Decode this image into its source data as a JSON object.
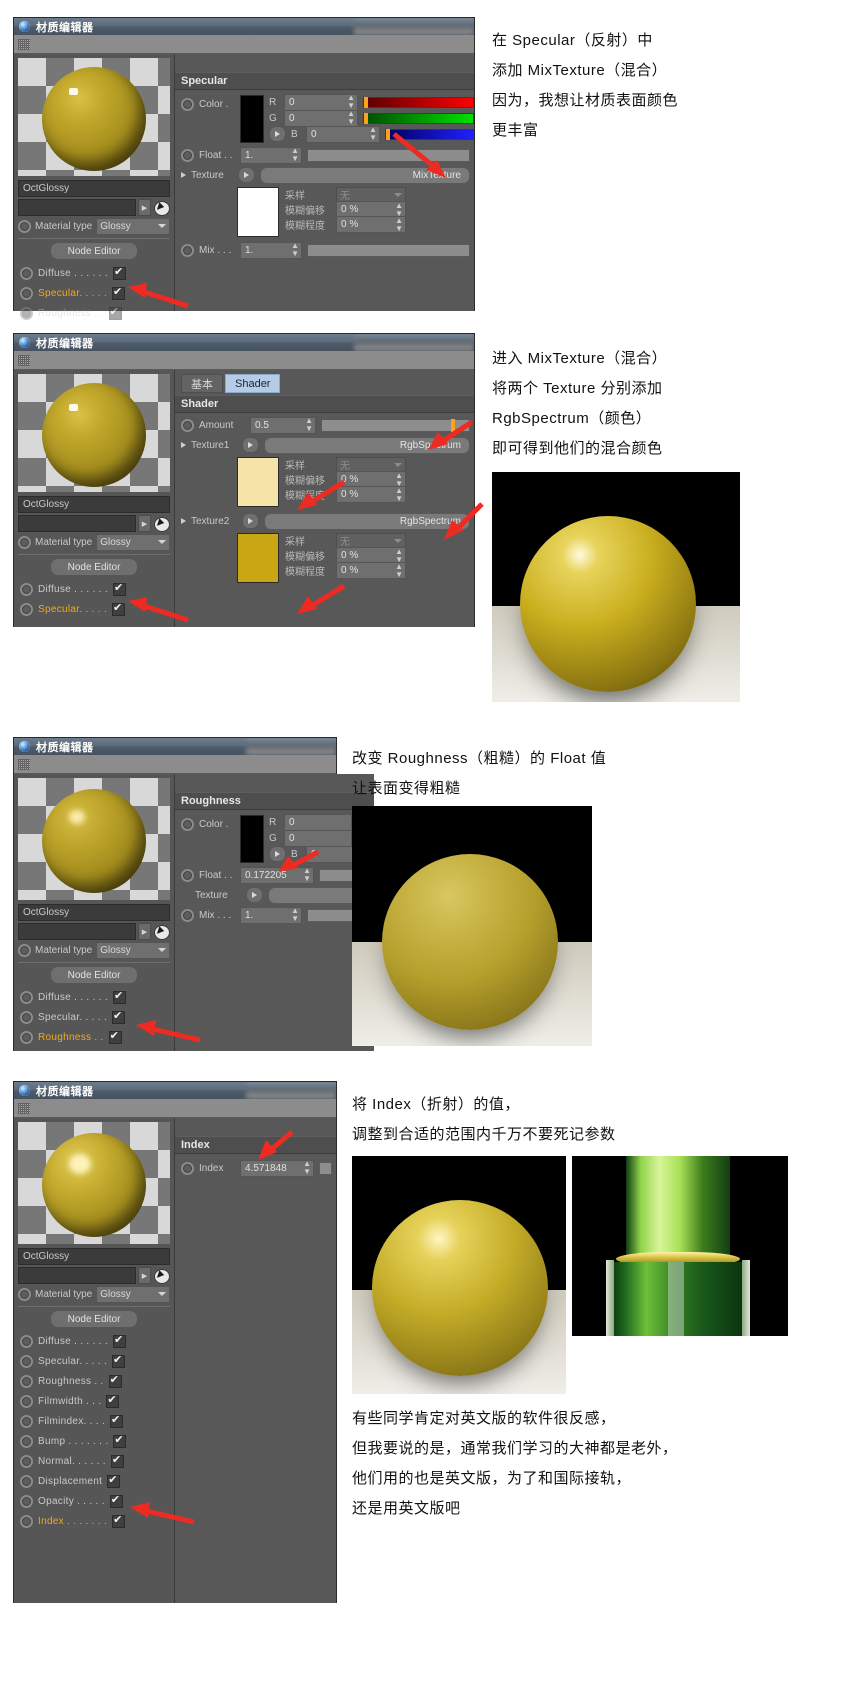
{
  "window": {
    "title": "材质编辑器",
    "logo_icon": "octane-logo-icon",
    "gripper_icon": "drag-gripper-icon"
  },
  "common": {
    "material_name": "OctGlossy",
    "material_type_label": "Material type",
    "material_type_value": "Glossy",
    "node_editor_label": "Node Editor",
    "sampling_label": "采样",
    "sampling_value": "无",
    "blur_offset_label": "模糊偏移",
    "blur_offset_value": "0 %",
    "blur_amount_label": "模糊程度",
    "blur_amount_value": "0 %",
    "cursor_icon": "pick-cursor-icon",
    "link_arrow_icon": "chevron-right-icon",
    "dropdown_icon": "chevron-down-icon",
    "expand_icon": "triangle-right-icon",
    "checkmark_icon": "check-icon",
    "radio_icon": "radio-button-icon",
    "arrow_pointer_icon": "red-arrow-icon"
  },
  "panel1": {
    "section_title": "Specular",
    "color_label": "Color .",
    "color_swatch": "#000000",
    "channels_rgb": [
      {
        "name": "R",
        "value": "0"
      },
      {
        "name": "G",
        "value": "0"
      },
      {
        "name": "B",
        "value": "0"
      }
    ],
    "float_label": "Float . .",
    "float_value": "1.",
    "texture_label": "Texture",
    "texture_value": "MixTexture",
    "texture_swatch": "#ffffff",
    "mix_label": "Mix . . .",
    "mix_value": "1.",
    "channel_list": [
      {
        "label": "Diffuse . . . . . .",
        "checked": true,
        "active": false
      },
      {
        "label": "Specular. . . . .",
        "checked": true,
        "active": true
      },
      {
        "label": "Roughness . .",
        "checked": true,
        "active": false
      }
    ]
  },
  "panel1_text": [
    "在 Specular（反射）中",
    "添加 MixTexture（混合）",
    "因为，我想让材质表面颜色",
    "更丰富"
  ],
  "panel2": {
    "tabs": [
      {
        "label": "基本",
        "selected": false
      },
      {
        "label": "Shader",
        "selected": true
      }
    ],
    "section_title": "Shader",
    "amount_label": "Amount",
    "amount_value": "0.5",
    "texture1_label": "Texture1",
    "texture1_value": "RgbSpectrum",
    "texture1_swatch": "#f5e3a8",
    "texture2_label": "Texture2",
    "texture2_value": "RgbSpectrum",
    "texture2_swatch": "#c9a612",
    "channel_list": [
      {
        "label": "Diffuse . . . . . .",
        "checked": true,
        "active": false
      },
      {
        "label": "Specular. . . . .",
        "checked": true,
        "active": true
      }
    ]
  },
  "panel2_text": [
    "进入 MixTexture（混合）",
    "将两个 Texture 分别添加",
    "RgbSpectrum（颜色）",
    "即可得到他们的混合颜色"
  ],
  "panel3": {
    "section_title": "Roughness",
    "color_label": "Color .",
    "color_swatch": "#000000",
    "channels_rgb": [
      {
        "name": "R",
        "value": "0"
      },
      {
        "name": "G",
        "value": "0"
      },
      {
        "name": "B",
        "value": "0"
      }
    ],
    "float_label": "Float . .",
    "float_value": "0.172205",
    "texture_label": "Texture",
    "texture_value": "",
    "mix_label": "Mix . . .",
    "mix_value": "1.",
    "channel_list": [
      {
        "label": "Diffuse . . . . . .",
        "checked": true,
        "active": false
      },
      {
        "label": "Specular. . . . .",
        "checked": true,
        "active": false
      },
      {
        "label": "Roughness . .",
        "checked": true,
        "active": true
      }
    ]
  },
  "panel3_text": [
    "改变 Roughness（粗糙）的 Float 值",
    "让表面变得粗糙"
  ],
  "panel4": {
    "section_title": "Index",
    "index_label": "Index",
    "index_value": "4.571848",
    "channel_list": [
      {
        "label": "Diffuse . . . . . .",
        "checked": true,
        "active": false
      },
      {
        "label": "Specular. . . . .",
        "checked": true,
        "active": false
      },
      {
        "label": "Roughness . .",
        "checked": true,
        "active": false
      },
      {
        "label": "Filmwidth . . .",
        "checked": true,
        "active": false
      },
      {
        "label": "Filmindex. . . .",
        "checked": true,
        "active": false
      },
      {
        "label": "Bump . . . . . . .",
        "checked": true,
        "active": false
      },
      {
        "label": "Normal. . . . . .",
        "checked": true,
        "active": false
      },
      {
        "label": "Displacement",
        "checked": true,
        "active": false
      },
      {
        "label": "Opacity . . . . .",
        "checked": true,
        "active": false
      },
      {
        "label": "Index . . . . . . .",
        "checked": true,
        "active": true
      }
    ]
  },
  "panel4_text": [
    "将 Index（折射）的值，",
    "调整到合适的范围内千万不要死记参数"
  ],
  "footer_text": [
    "有些同学肯定对英文版的软件很反感，",
    "但我要说的是，通常我们学习的大神都是老外，",
    "他们用的也是英文版，为了和国际接轨，",
    "还是用英文版吧"
  ],
  "colors": {
    "accent_orange": "#f3a81a",
    "arrow_red": "#ee2b22",
    "panel_bg": "#585858",
    "tab_selected": "#b6cbe6"
  }
}
